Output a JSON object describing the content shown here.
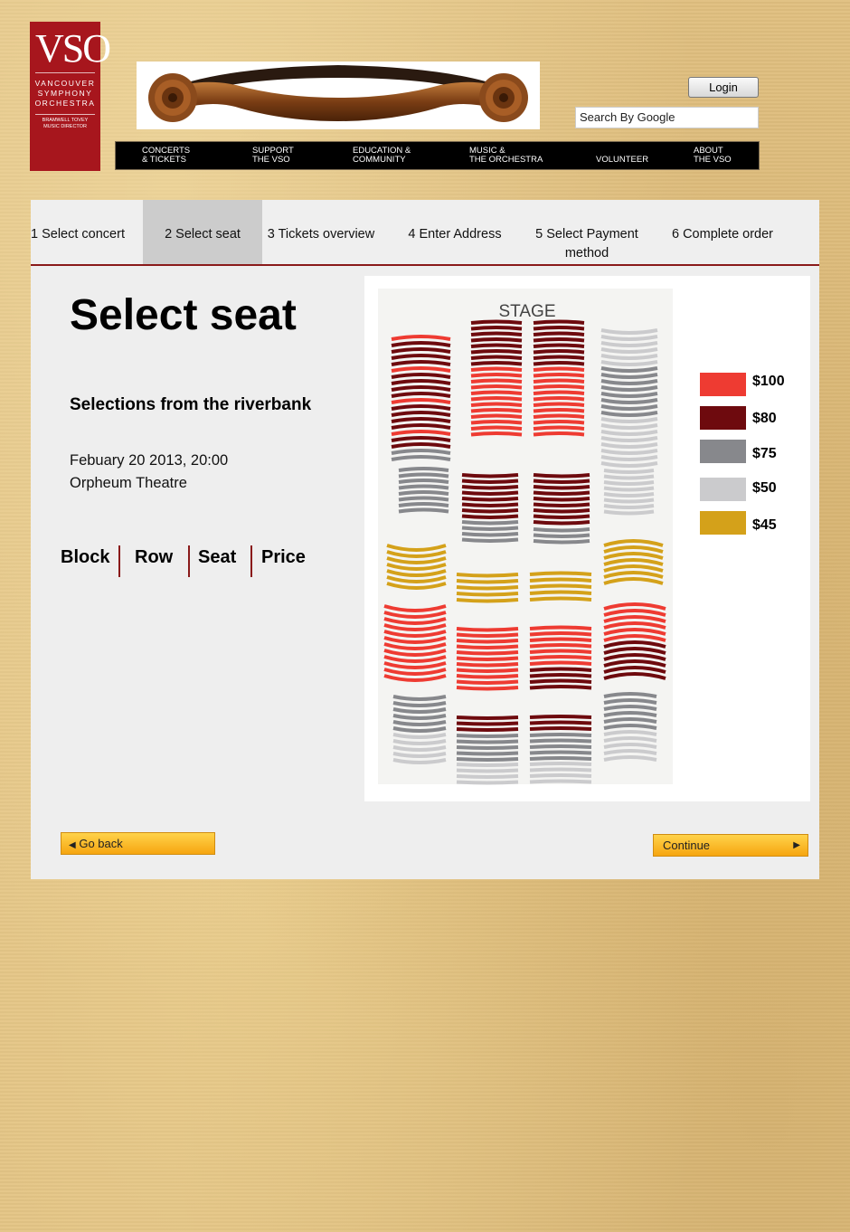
{
  "logo": {
    "big": "VSO",
    "lines": [
      "VANCOUVER",
      "SYMPHONY",
      "ORCHESTRA"
    ],
    "director": [
      "BRAMWELL TOVEY",
      "MUSIC DIRECTOR"
    ]
  },
  "header": {
    "login_label": "Login",
    "search_placeholder": "Search By Google"
  },
  "nav": {
    "items": [
      {
        "line1": "CONCERTS",
        "line2": "& TICKETS"
      },
      {
        "line1": "SUPPORT",
        "line2": "THE VSO"
      },
      {
        "line1": "EDUCATION &",
        "line2": "COMMUNITY"
      },
      {
        "line1": "MUSIC &",
        "line2": "THE ORCHESTRA"
      },
      {
        "line1": "",
        "line2": "VOLUNTEER"
      },
      {
        "line1": "ABOUT",
        "line2": "THE VSO"
      }
    ]
  },
  "steps": [
    {
      "label": "1 Select concert"
    },
    {
      "label": "2 Select seat"
    },
    {
      "label": "3 Tickets overview"
    },
    {
      "label": "4 Enter Address"
    },
    {
      "label": "5 Select Payment method"
    },
    {
      "label": "6 Complete order"
    }
  ],
  "main": {
    "title": "Select seat",
    "concert": "Selections from the riverbank",
    "date": "Febuary 20 2013, 20:00",
    "venue": "Orpheum Theatre",
    "columns": [
      "Block",
      "Row",
      "Seat",
      "Price"
    ]
  },
  "seatmap": {
    "stage_label": "STAGE",
    "legend": [
      {
        "label": "$100",
        "color": "#ee3b32"
      },
      {
        "label": "$80",
        "color": "#6e0a0e"
      },
      {
        "label": "$75",
        "color": "#87888c"
      },
      {
        "label": "$50",
        "color": "#cbcbcd"
      },
      {
        "label": "$45",
        "color": "#d4a11a"
      }
    ]
  },
  "buttons": {
    "back": "Go back",
    "continue": "Continue"
  }
}
